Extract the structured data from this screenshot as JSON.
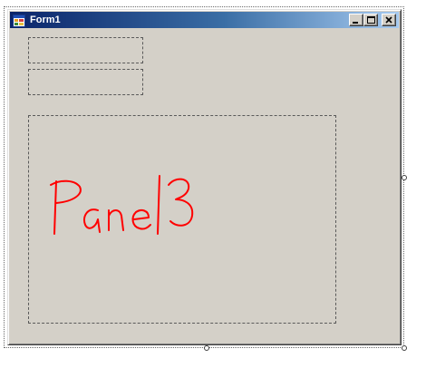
{
  "window": {
    "title": "Form1",
    "icon": "form-app-icon",
    "controls": [
      "minimize-icon",
      "maximize-icon",
      "close-icon"
    ]
  },
  "panels": [
    {
      "name": "panel1",
      "text": ""
    },
    {
      "name": "panel2",
      "text": ""
    },
    {
      "name": "panel3",
      "text": "Panel3",
      "annotation_color": "#ff0000"
    }
  ],
  "colors": {
    "form_background": "#d4d0c8",
    "title_gradient_start": "#0a246a",
    "title_gradient_end": "#a6caf0",
    "annotation": "#ff0000"
  }
}
